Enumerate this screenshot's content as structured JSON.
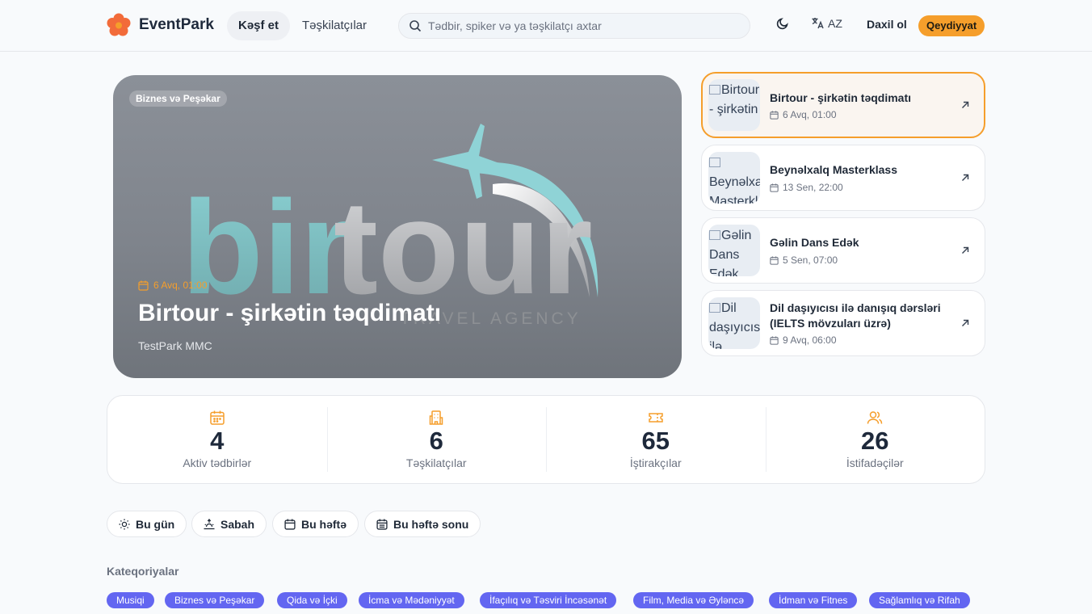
{
  "header": {
    "brand": "EventPark",
    "nav": {
      "explore": "Kəşf et",
      "organizers": "Təşkilatçılar"
    },
    "search_placeholder": "Tədbir, spiker və ya təşkilatçı axtar",
    "language": "AZ",
    "login": "Daxil ol",
    "register": "Qeydiyyat",
    "accent_color": "#f59e2b"
  },
  "hero": {
    "badge": "Biznes və Peşəkar",
    "date": "6 Avq, 01:00",
    "title": "Birtour - şirkətin təqdimatı",
    "organizer": "TestPark MMC",
    "logo_word_left": "bir",
    "logo_word_right": "tour",
    "logo_tagline": "TRAVEL AGENCY"
  },
  "upcoming": [
    {
      "title": "Birtour - şirkətin təqdimatı",
      "date": "6 Avq, 01:00",
      "thumb_alt": "Birtour - şirkətin",
      "active": true
    },
    {
      "title": "Beynəlxalq Masterklass",
      "date": "13 Sen, 22:00",
      "thumb_alt": "Beynəlxalq Masterklass"
    },
    {
      "title": "Gəlin Dans Edək",
      "date": "5 Sen, 07:00",
      "thumb_alt": "Gəlin Dans Edək"
    },
    {
      "title": "Dil daşıyıcısı ilə danışıq dərsləri (IELTS mövzuları üzrə)",
      "date": "9 Avq, 06:00",
      "thumb_alt": "Dil daşıyıcısı ilə"
    }
  ],
  "stats": [
    {
      "icon": "calendar-icon",
      "value": "4",
      "label": "Aktiv tədbirlər"
    },
    {
      "icon": "building-icon",
      "value": "6",
      "label": "Təşkilatçılar"
    },
    {
      "icon": "ticket-icon",
      "value": "65",
      "label": "İştirakçılar"
    },
    {
      "icon": "users-icon",
      "value": "26",
      "label": "İstifadəçilər"
    }
  ],
  "quick_filters": [
    {
      "icon": "sun-icon",
      "label": "Bu gün"
    },
    {
      "icon": "sunrise-icon",
      "label": "Sabah"
    },
    {
      "icon": "calendar-icon",
      "label": "Bu həftə"
    },
    {
      "icon": "calendar-days-icon",
      "label": "Bu həftə sonu"
    }
  ],
  "categories_heading": "Kateqoriyalar",
  "categories": [
    "Musiqi",
    "Biznes və Peşəkar",
    "Qida və İçki",
    "İcma və Mədəniyyət",
    "İfaçılıq və Təsviri İncəsənət",
    "Film, Media və Əyləncə",
    "İdman və Fitnes",
    "Sağlamlıq və Rifah"
  ],
  "category_color": "#6366f1"
}
